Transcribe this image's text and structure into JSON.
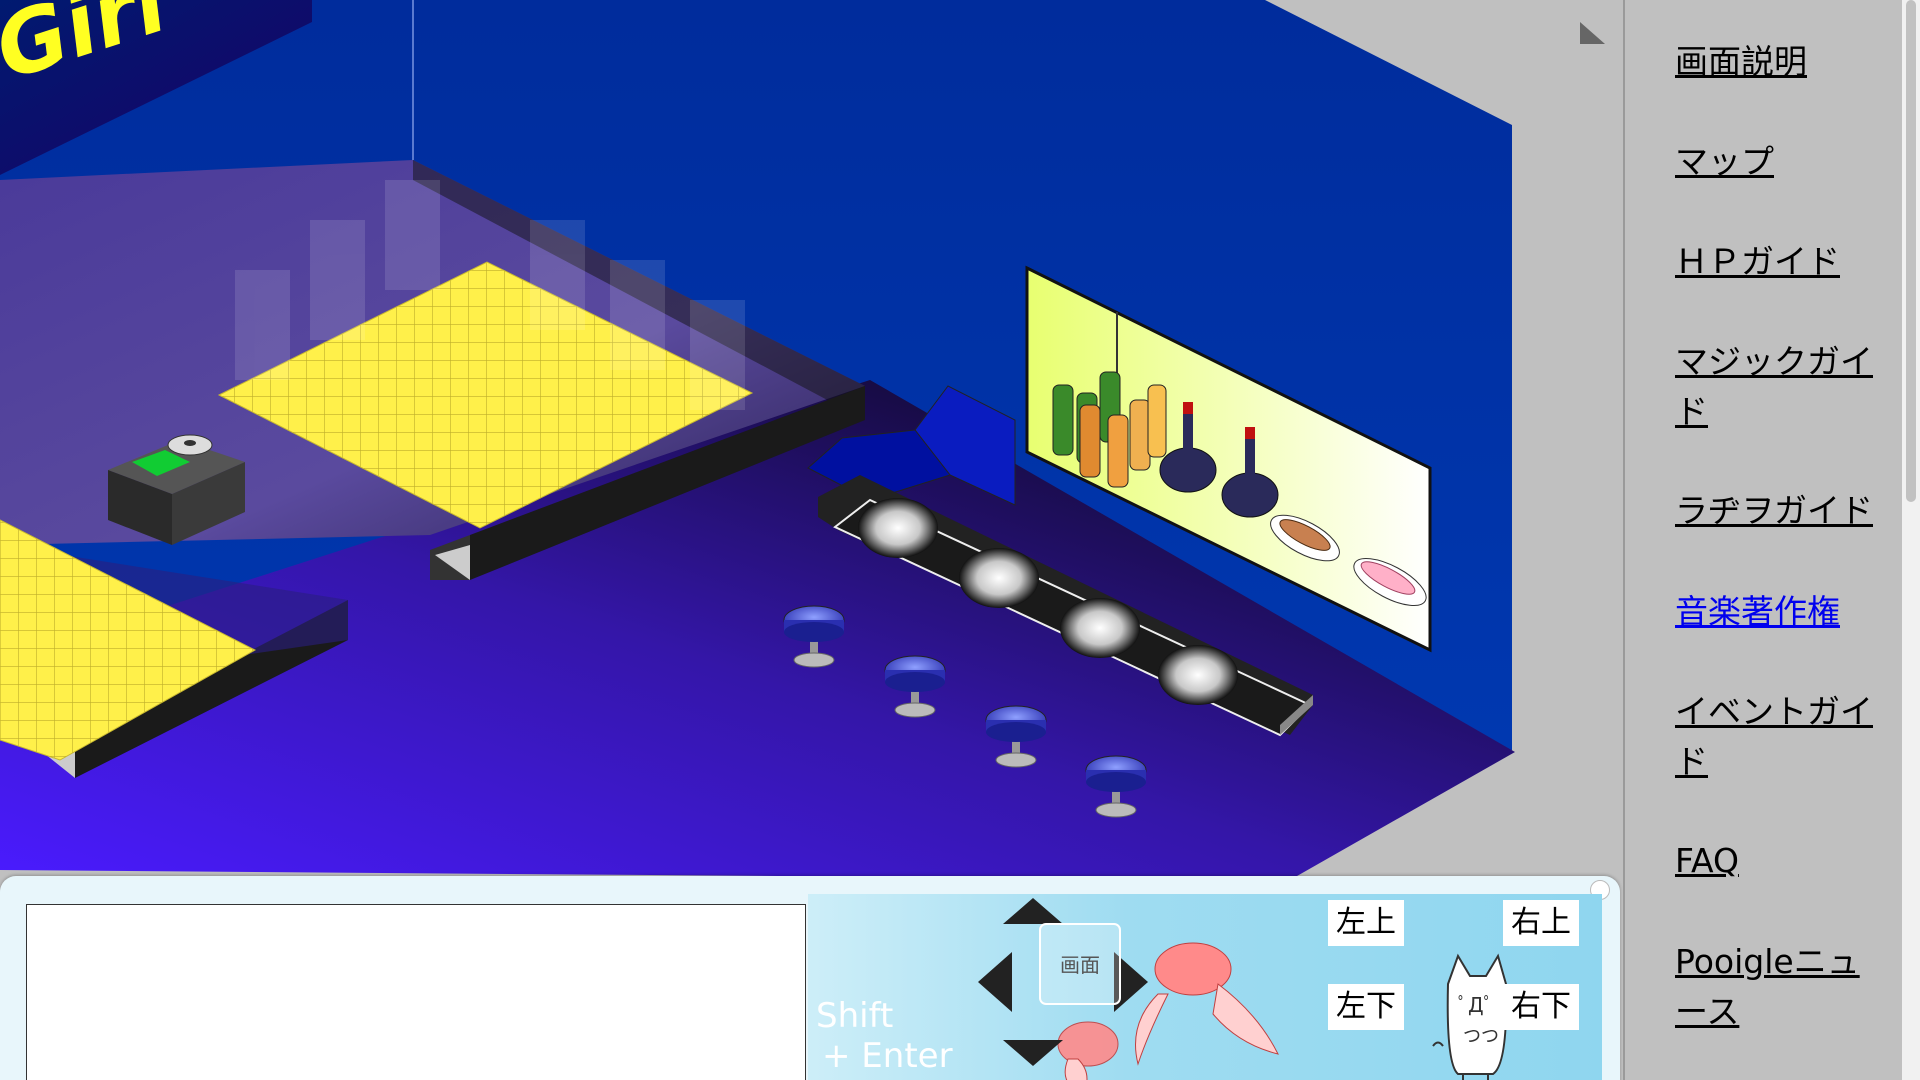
{
  "sidebar": {
    "links": [
      {
        "label": "画面説明",
        "current": false
      },
      {
        "label": "マップ",
        "current": false
      },
      {
        "label": "ＨＰガイド",
        "current": false
      },
      {
        "label": "マジックガイド",
        "current": false
      },
      {
        "label": "ラヂヲガイド",
        "current": false
      },
      {
        "label": "音楽著作権",
        "current": true
      },
      {
        "label": "イベントガイド",
        "current": false
      },
      {
        "label": "FAQ",
        "current": false
      },
      {
        "label": "Pooigleニュース",
        "current": false
      }
    ]
  },
  "scene": {
    "sign_text": "Girl"
  },
  "chat": {
    "input_value": "",
    "shift_label": "Shift",
    "enter_label": "+ Enter",
    "center_button_label": "画面",
    "dir_up_left": "左上",
    "dir_up_right": "右上",
    "dir_down_left": "左下",
    "dir_down_right": "右下"
  },
  "colors": {
    "back_wall": "#0033a0",
    "floor": "#3a1ad6",
    "dance_tile": "#fff04a",
    "sidebar_bg": "#c0c0c0",
    "current_link": "#0000ee",
    "pad_bg": "#8fd6ef"
  }
}
